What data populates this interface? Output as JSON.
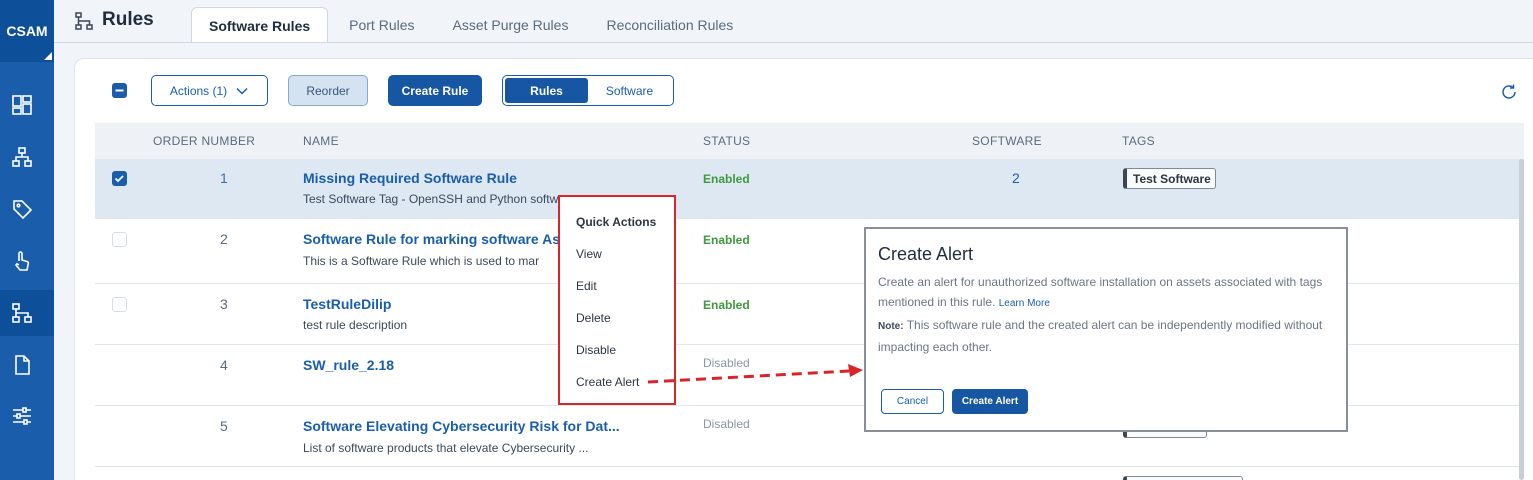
{
  "sidebar": {
    "brand": "CSAM",
    "icons": [
      "dashboard-icon",
      "hierarchy-icon",
      "tag-icon",
      "touch-icon",
      "rules-icon",
      "document-icon",
      "sliders-icon"
    ]
  },
  "header": {
    "title": "Rules",
    "tabs": [
      "Software Rules",
      "Port Rules",
      "Asset Purge Rules",
      "Reconciliation Rules"
    ],
    "active_tab": "Software Rules"
  },
  "toolbar": {
    "actions_label": "Actions (1)",
    "reorder_label": "Reorder",
    "create_rule_label": "Create Rule",
    "view_toggle": [
      "Rules",
      "Software"
    ],
    "view_selected": "Rules"
  },
  "table": {
    "columns": [
      "ORDER NUMBER",
      "NAME",
      "STATUS",
      "SOFTWARE",
      "TAGS"
    ],
    "rows": [
      {
        "order": "1",
        "name": "Missing Required Software Rule",
        "desc": "Test Software Tag - OpenSSH and Python softwa",
        "status": "Enabled",
        "software": "2",
        "tag": "Test Software",
        "selected": true
      },
      {
        "order": "2",
        "name": "Software Rule for marking software As",
        "desc": "This is a Software Rule which is used to mar",
        "status": "Enabled"
      },
      {
        "order": "3",
        "name": "TestRuleDilip",
        "desc": "test rule description",
        "status": "Enabled"
      },
      {
        "order": "4",
        "name": "SW_rule_2.18",
        "desc": "",
        "status": "Disabled"
      },
      {
        "order": "5",
        "name": "Software Elevating Cybersecurity Risk for Dat...",
        "desc": "List of software products that elevate Cybersecurity ...",
        "status": "Disabled"
      }
    ]
  },
  "quick_actions": {
    "title": "Quick Actions",
    "items": [
      "View",
      "Edit",
      "Delete",
      "Disable",
      "Create Alert"
    ]
  },
  "alert": {
    "title": "Create Alert",
    "text": "Create an alert for unauthorized software installation on assets associated with tags mentioned in this rule.",
    "link": "Learn More",
    "note_label": "Note:",
    "note": "This software rule and the created alert can be independently modified without impacting each other.",
    "cancel": "Cancel",
    "create": "Create Alert"
  },
  "colors": {
    "brand": "#1a5eab",
    "enabled": "#3e9a3e",
    "highlight": "#d9242b"
  }
}
